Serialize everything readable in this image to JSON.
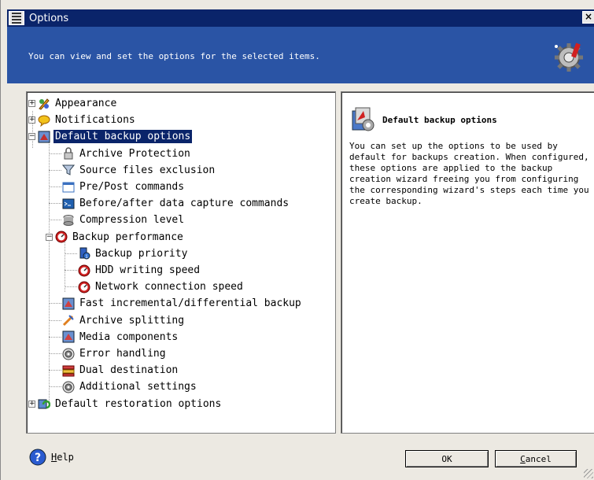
{
  "window": {
    "title": "Options"
  },
  "header": {
    "message": "You can view and set the options for the selected items."
  },
  "tree": {
    "items": [
      {
        "label": "Appearance",
        "level": 0,
        "expander": "+",
        "icon": "appearance-icon",
        "color": "#e8a020"
      },
      {
        "label": "Notifications",
        "level": 0,
        "expander": "+",
        "icon": "notifications-icon",
        "color": "#f2c21b"
      },
      {
        "label": "Default backup options",
        "level": 0,
        "expander": "−",
        "icon": "backup-options-icon",
        "color": "#c03030",
        "selected": true
      },
      {
        "label": "Archive Protection",
        "level": 1,
        "icon": "lock-icon",
        "color": "#a0a0a0"
      },
      {
        "label": "Source files exclusion",
        "level": 1,
        "icon": "filter-icon",
        "color": "#5080c0"
      },
      {
        "label": "Pre/Post commands",
        "level": 1,
        "icon": "window-icon",
        "color": "#3a70c0"
      },
      {
        "label": "Before/after data capture commands",
        "level": 1,
        "icon": "console-icon",
        "color": "#2060b0"
      },
      {
        "label": "Compression level",
        "level": 1,
        "icon": "compression-icon",
        "color": "#808080"
      },
      {
        "label": "Backup performance",
        "level": 1,
        "expander": "−",
        "icon": "performance-icon",
        "color": "#d02020"
      },
      {
        "label": "Backup priority",
        "level": 2,
        "icon": "priority-icon",
        "color": "#3060c0"
      },
      {
        "label": "HDD writing speed",
        "level": 2,
        "icon": "speed-icon",
        "color": "#d02020"
      },
      {
        "label": "Network connection speed",
        "level": 2,
        "icon": "speed-icon",
        "color": "#d02020"
      },
      {
        "label": "Fast incremental/differential backup",
        "level": 1,
        "icon": "incremental-icon",
        "color": "#d04040"
      },
      {
        "label": "Archive splitting",
        "level": 1,
        "icon": "splitting-icon",
        "color": "#e08020"
      },
      {
        "label": "Media components",
        "level": 1,
        "icon": "media-icon",
        "color": "#d04040"
      },
      {
        "label": "Error handling",
        "level": 1,
        "icon": "error-gear-icon",
        "color": "#606060"
      },
      {
        "label": "Dual destination",
        "level": 1,
        "icon": "dual-destination-icon",
        "color": "#d04040"
      },
      {
        "label": "Additional settings",
        "level": 1,
        "icon": "settings-icon",
        "color": "#606060"
      },
      {
        "label": "Default restoration options",
        "level": 0,
        "expander": "+",
        "icon": "restoration-icon",
        "color": "#30a030"
      }
    ]
  },
  "info": {
    "title": "Default backup options",
    "text": "You can set up the options to be used by default for backups creation. When configured, these options are applied to the backup creation wizard freeing you from configuring the corresponding wizard's steps each time you create backup."
  },
  "footer": {
    "help_label": "Help",
    "ok_label": "OK",
    "cancel_label": "Cancel"
  },
  "colors": {
    "title_bar": "#0a246a",
    "header_bg": "#2a54a5",
    "selection": "#0a246a"
  }
}
